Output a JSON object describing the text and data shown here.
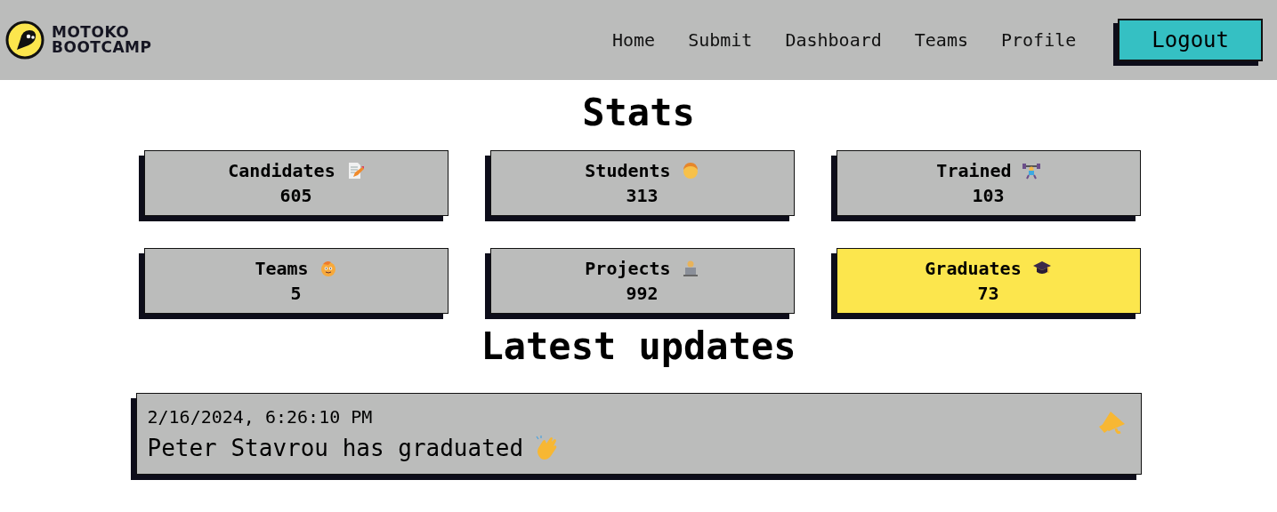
{
  "header": {
    "brand": [
      "MOTOKO",
      "BOOTCAMP"
    ],
    "nav": [
      "Home",
      "Submit",
      "Dashboard",
      "Teams",
      "Profile"
    ],
    "logout": "Logout"
  },
  "stats": {
    "title": "Stats",
    "cards": [
      {
        "label": "Candidates",
        "value": "605",
        "highlighted": false
      },
      {
        "label": "Students",
        "value": "313",
        "highlighted": false
      },
      {
        "label": "Trained",
        "value": "103",
        "highlighted": false
      },
      {
        "label": "Teams",
        "value": "5",
        "highlighted": false
      },
      {
        "label": "Projects",
        "value": "992",
        "highlighted": false
      },
      {
        "label": "Graduates",
        "value": "73",
        "highlighted": true
      }
    ]
  },
  "updates": {
    "title": "Latest updates",
    "items": [
      {
        "time": "2/16/2024, 6:26:10 PM",
        "message": "Peter Stavrou has graduated"
      }
    ]
  }
}
